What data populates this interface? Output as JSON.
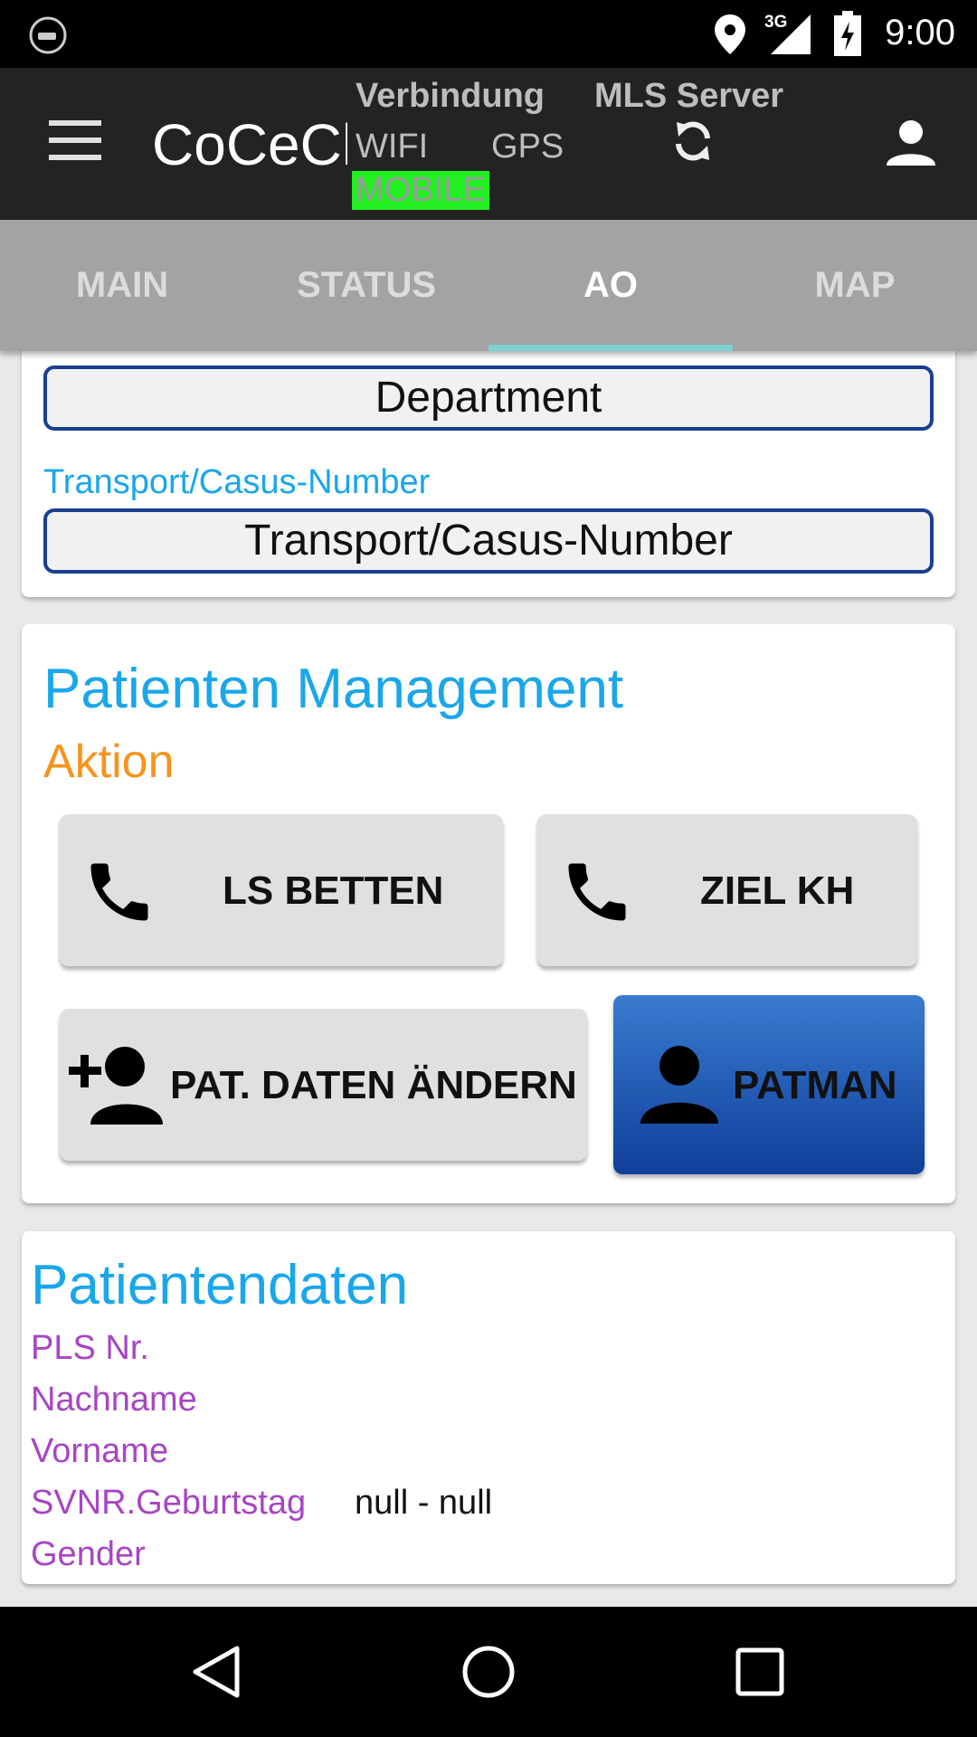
{
  "statusbar": {
    "network": "3G",
    "time": "9:00"
  },
  "appbar": {
    "title": "CoCeCl",
    "verbindung_label": "Verbindung",
    "server_label": "MLS Server",
    "wifi_label": "WIFI",
    "gps_label": "GPS",
    "mobile_label": "MOBILE",
    "mobile_color": "#22ee22"
  },
  "tabs": [
    {
      "label": "MAIN"
    },
    {
      "label": "STATUS"
    },
    {
      "label": "AO",
      "active": true
    },
    {
      "label": "MAP"
    }
  ],
  "form": {
    "department_value": "Department",
    "transport_label": "Transport/Casus-Number",
    "transport_value": "Transport/Casus-Number"
  },
  "patient_management": {
    "title": "Patienten Management",
    "subtitle": "Aktion",
    "buttons": {
      "ls_betten": "LS BETTEN",
      "ziel_kh": "ZIEL KH",
      "pat_daten": "PAT. DATEN ÄNDERN",
      "patman": "PATMAN"
    }
  },
  "patient_data": {
    "title": "Patientendaten",
    "fields": {
      "pls": "PLS Nr.",
      "nachname": "Nachname",
      "vorname": "Vorname",
      "svnr": "SVNR.Geburtstag",
      "svnr_value": "null - null",
      "gender": "Gender"
    }
  },
  "colors": {
    "accent_blue": "#1aa6ea",
    "accent_orange": "#f7941d",
    "label_purple": "#a745c4",
    "primary_button": "#1a56b0"
  }
}
